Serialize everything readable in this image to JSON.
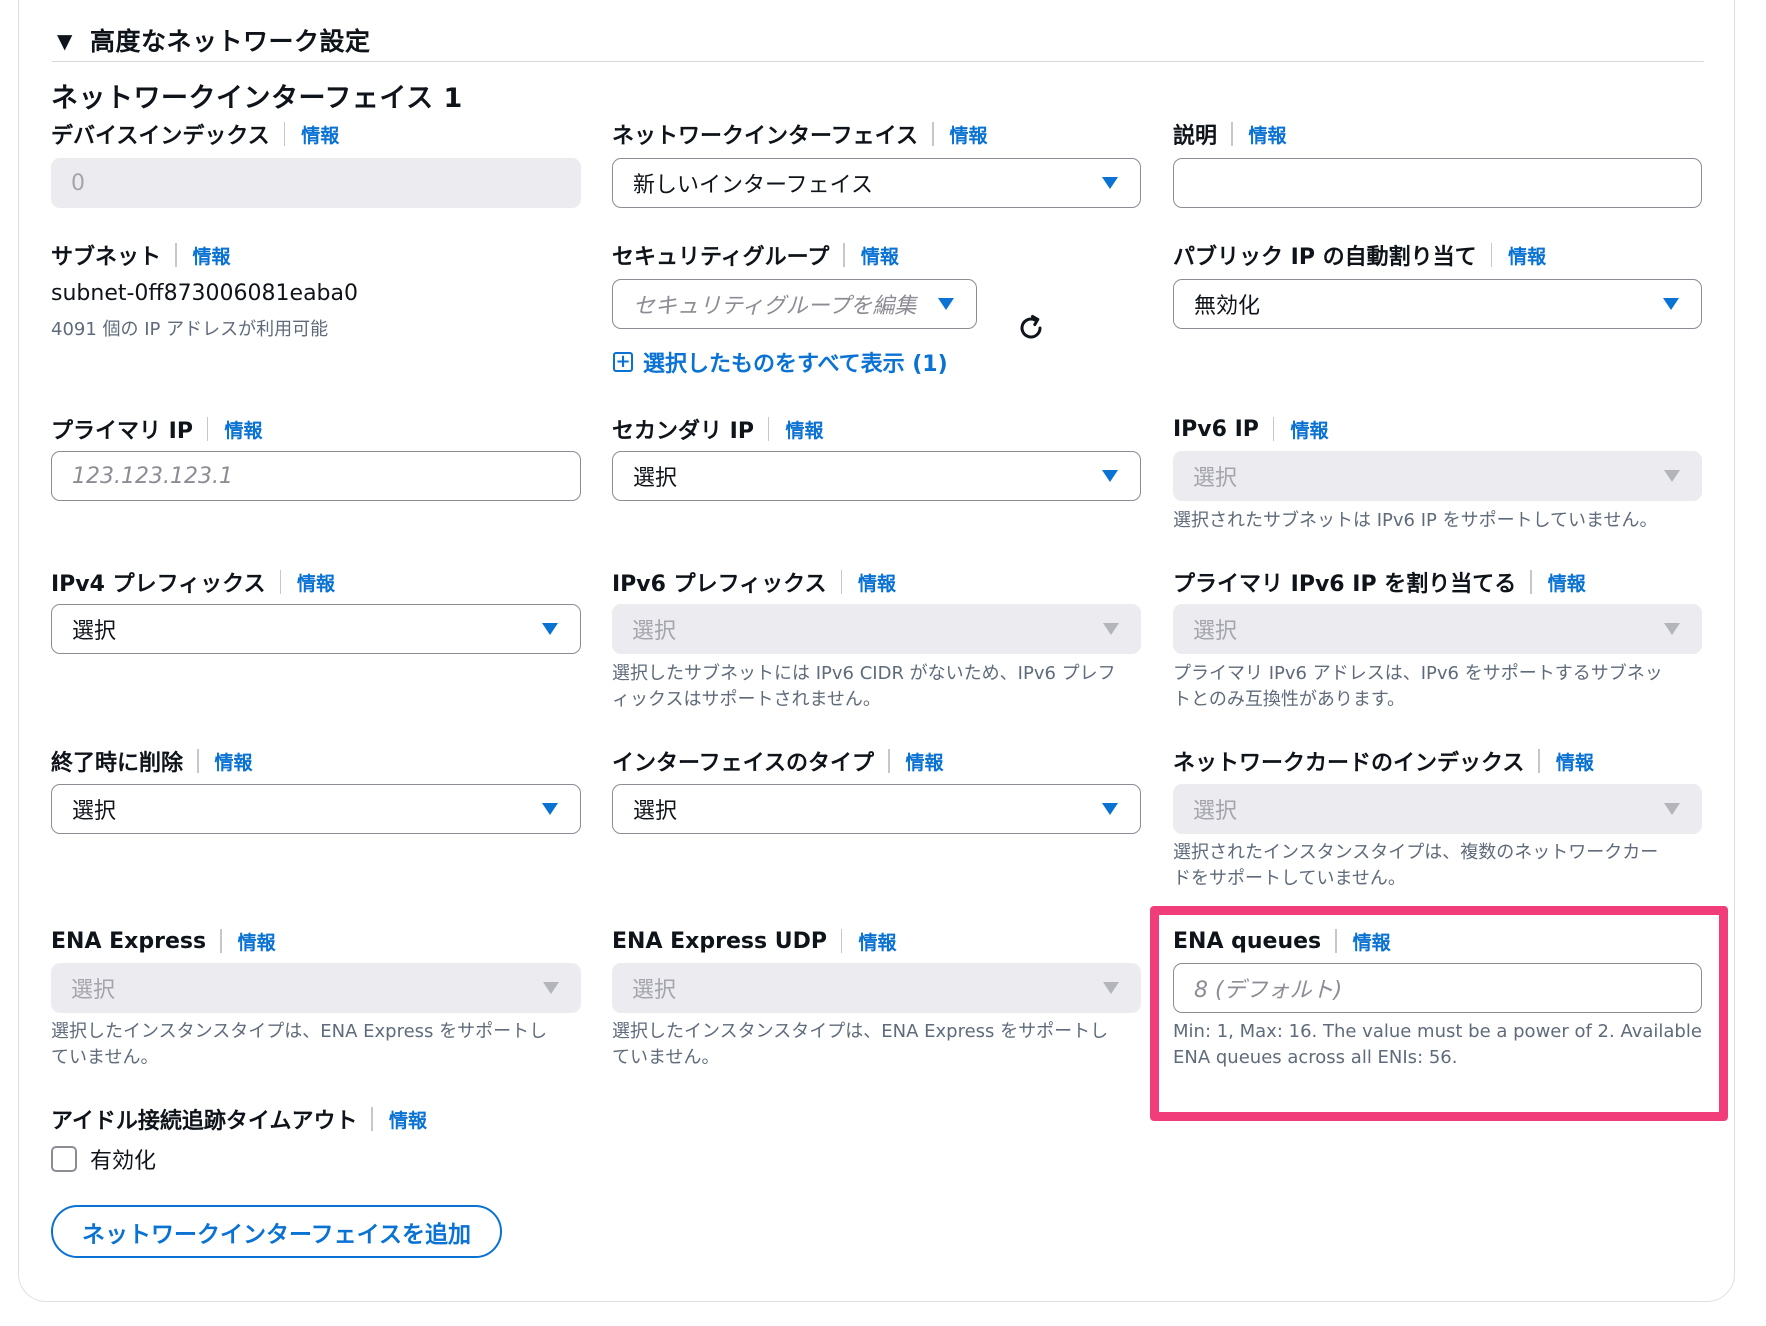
{
  "section": {
    "title": "高度なネットワーク設定"
  },
  "network_interface": {
    "title": "ネットワークインターフェイス 1",
    "info_label": "情報",
    "device_index": {
      "label": "デバイスインデックス",
      "value": "0"
    },
    "interface": {
      "label": "ネットワークインターフェイス",
      "value": "新しいインターフェイス"
    },
    "description": {
      "label": "説明",
      "value": ""
    },
    "subnet": {
      "label": "サブネット",
      "value": "subnet-0ff873006081eaba0",
      "available": "4091 個の IP アドレスが利用可能"
    },
    "security_group": {
      "label": "セキュリティグループ",
      "placeholder": "セキュリティグループを編集",
      "show_all_link": "選択したものをすべて表示 (1)"
    },
    "public_ip": {
      "label": "パブリック IP の自動割り当て",
      "value": "無効化"
    },
    "primary_ip": {
      "label": "プライマリ IP",
      "placeholder": "123.123.123.1"
    },
    "secondary_ip": {
      "label": "セカンダリ IP",
      "value": "選択"
    },
    "ipv6_ip": {
      "label": "IPv6 IP",
      "value": "選択",
      "hint": "選択されたサブネットは IPv6 IP をサポートしていません。"
    },
    "ipv4_prefix": {
      "label": "IPv4 プレフィックス",
      "value": "選択"
    },
    "ipv6_prefix": {
      "label": "IPv6 プレフィックス",
      "value": "選択",
      "hint_line1": "選択したサブネットには IPv6 CIDR がないため、IPv6 プレフ",
      "hint_line2": "ィックスはサポートされません。"
    },
    "primary_ipv6": {
      "label": "プライマリ IPv6 IP を割り当てる",
      "value": "選択",
      "hint_line1": "プライマリ IPv6 アドレスは、IPv6 をサポートするサブネッ",
      "hint_line2": "トとのみ互換性があります。"
    },
    "delete_on_termination": {
      "label": "終了時に削除",
      "value": "選択"
    },
    "interface_type": {
      "label": "インターフェイスのタイプ",
      "value": "選択"
    },
    "network_card_index": {
      "label": "ネットワークカードのインデックス",
      "value": "選択",
      "hint_line1": "選択されたインスタンスタイプは、複数のネットワークカー",
      "hint_line2": "ドをサポートしていません。"
    },
    "ena_express": {
      "label": "ENA Express",
      "value": "選択",
      "hint_line1": "選択したインスタンスタイプは、ENA Express をサポートし",
      "hint_line2": "ていません。"
    },
    "ena_express_udp": {
      "label": "ENA Express UDP",
      "value": "選択",
      "hint_line1": "選択したインスタンスタイプは、ENA Express をサポートし",
      "hint_line2": "ていません。"
    },
    "ena_queues": {
      "label": "ENA queues",
      "placeholder": "8 (デフォルト)",
      "hint_line1": "Min: 1, Max: 16. The value must be a power of 2. Available",
      "hint_line2": "ENA queues across all ENIs: 56."
    },
    "idle_timeout": {
      "label": "アイドル接続追跡タイムアウト",
      "checkbox_label": "有効化"
    }
  },
  "add_button": {
    "label": "ネットワークインターフェイスを追加"
  },
  "colors": {
    "accent": "#0972d3",
    "highlight": "#f23d7b",
    "disabled_bg": "#ebebf0"
  }
}
